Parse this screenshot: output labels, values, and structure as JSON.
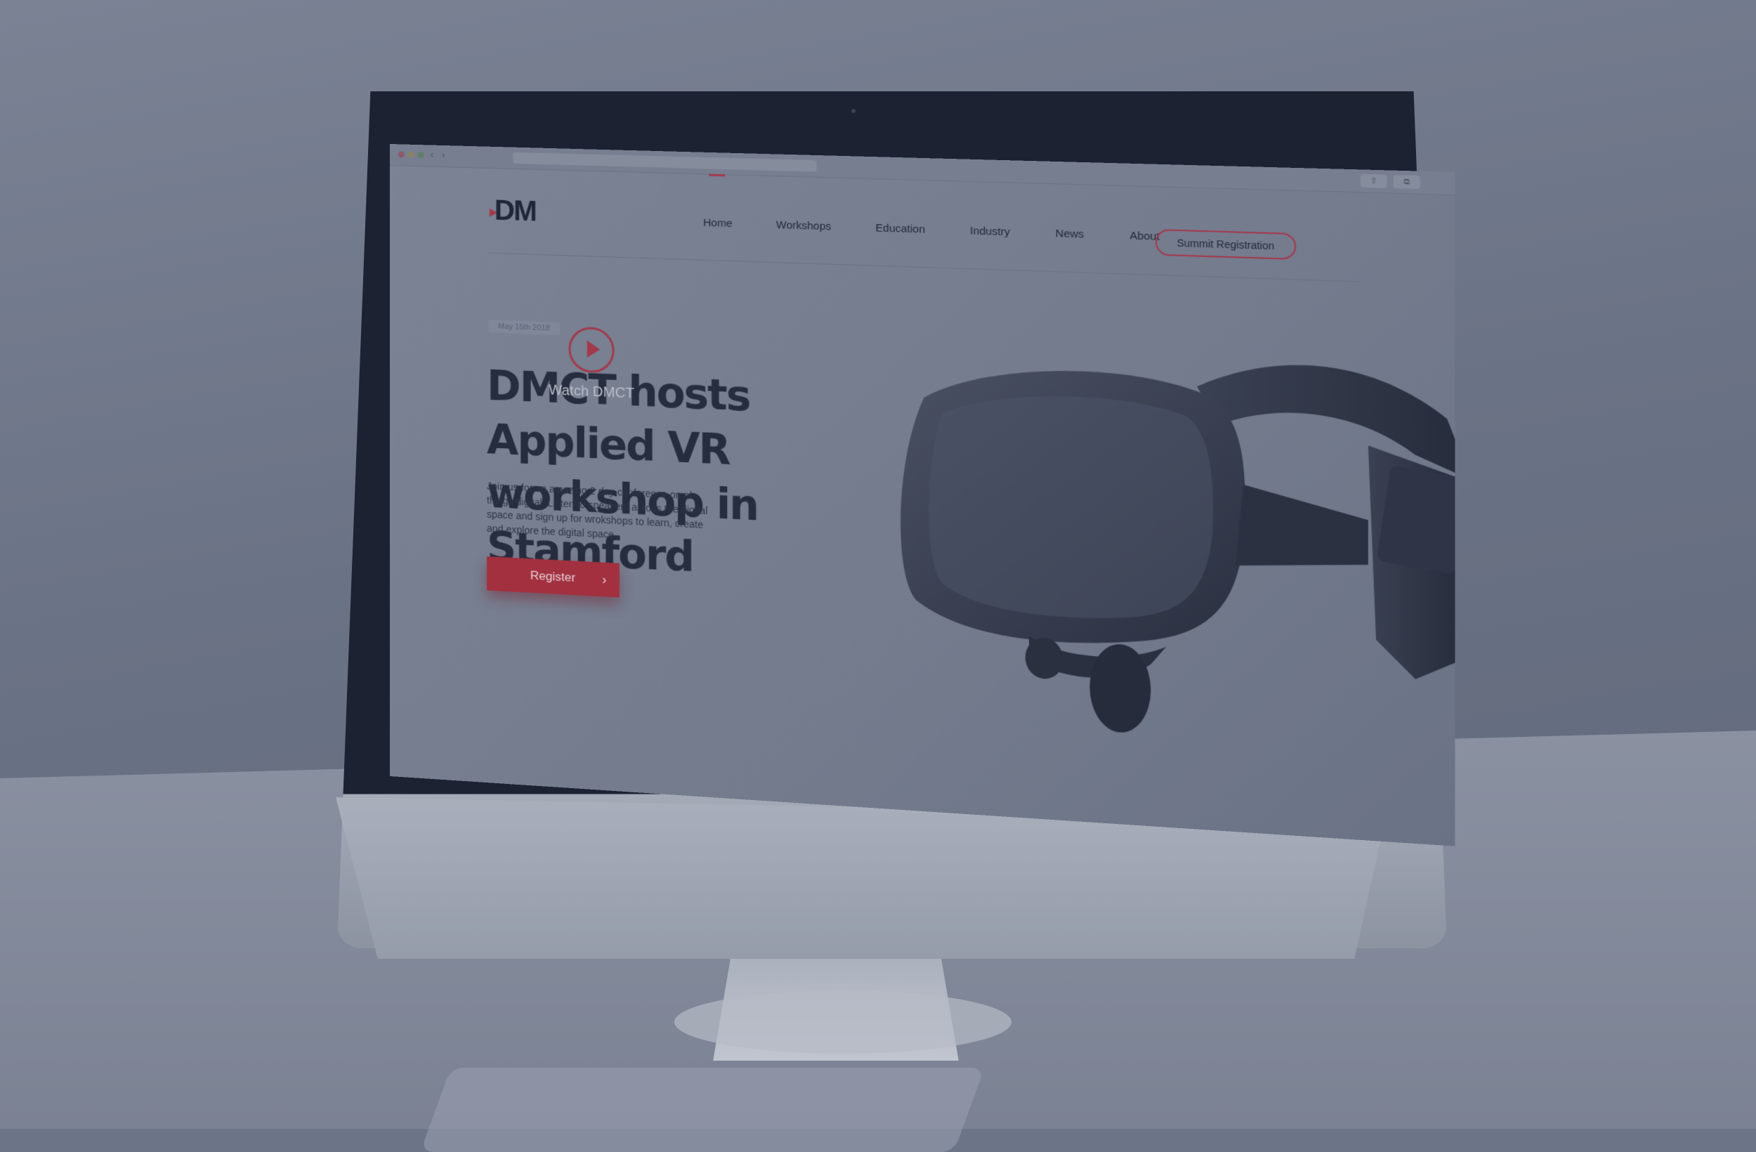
{
  "browser": {
    "back_glyph": "‹",
    "forward_glyph": "›",
    "share_glyph": "⇧",
    "tabs_glyph": "⧉"
  },
  "site": {
    "logo_text": "DM",
    "nav": {
      "home": "Home",
      "workshops": "Workshops",
      "education": "Education",
      "industry": "Industry",
      "news": "News",
      "about": "About"
    },
    "summit_button": "Summit Registration"
  },
  "hero": {
    "date": "May 15th 2018",
    "title": "DMCT hosts Applied VR workshop in Stamford",
    "body": "Join us for an amazing 2 day conference on al things digital. Listen to speakers across the digital space and sign up for wrokshops to learn, create and explore the digital space.",
    "register_label": "Register",
    "register_arrow": "›"
  },
  "video": {
    "watch_label": "Watch DMCT"
  },
  "colors": {
    "accent": "#a33a4c",
    "dark_text": "#262d3e"
  }
}
